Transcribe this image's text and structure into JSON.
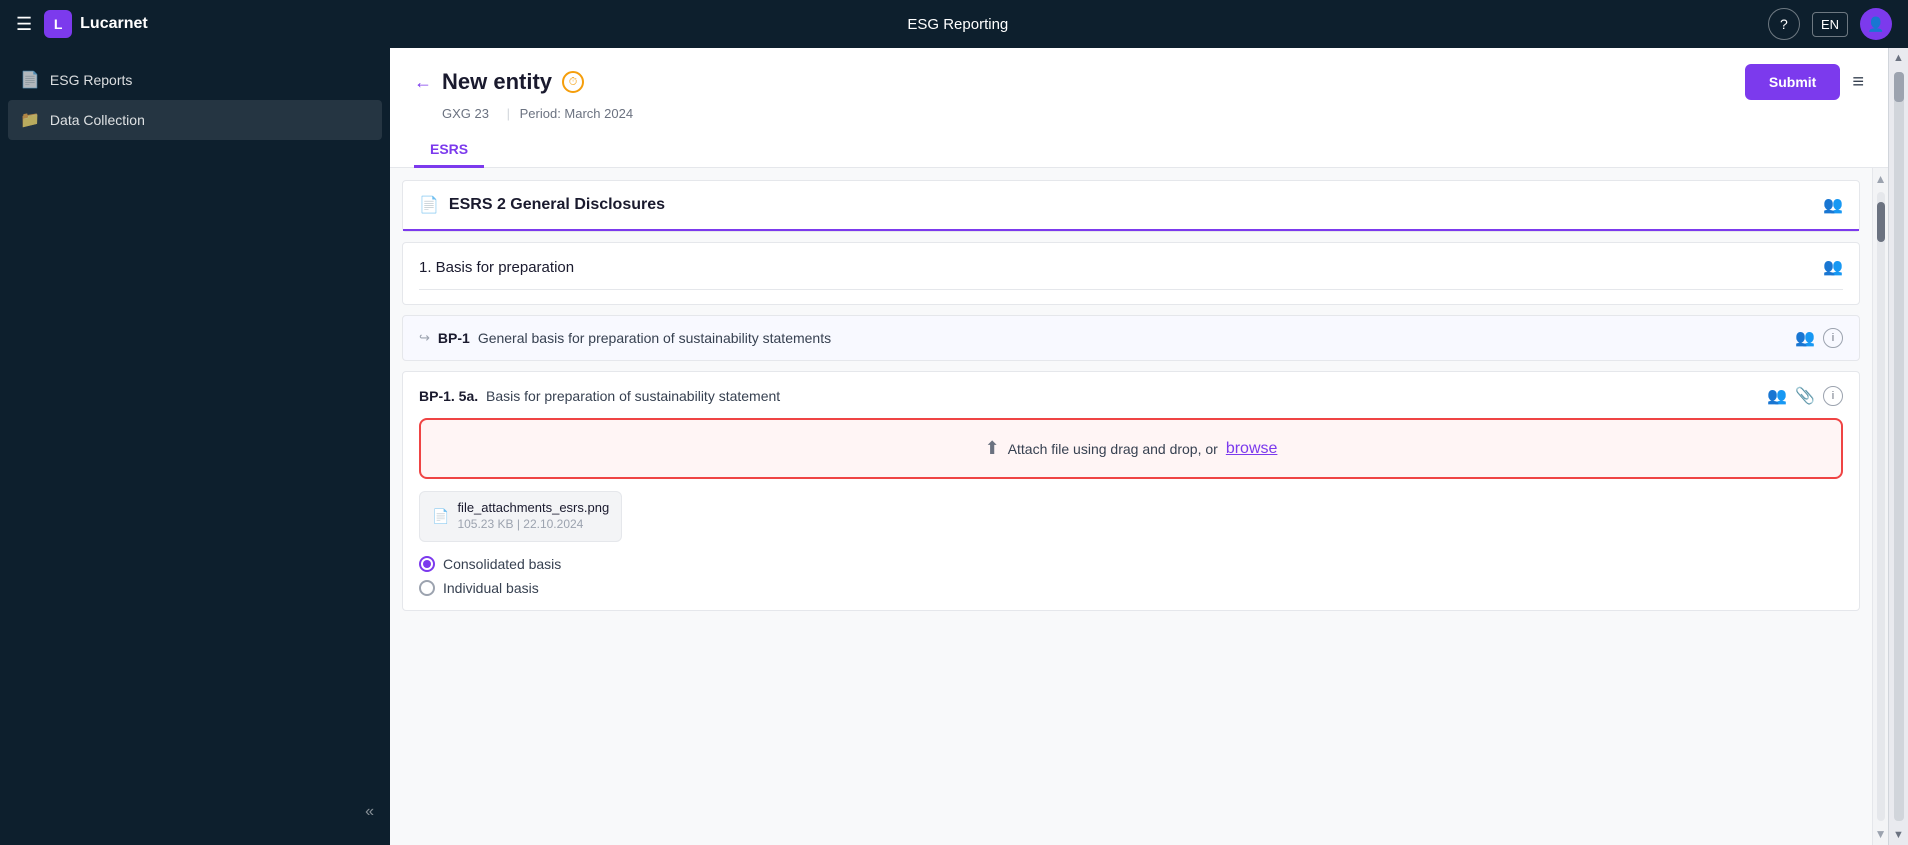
{
  "app": {
    "name": "Lucarnet",
    "title": "ESG Reporting"
  },
  "topnav": {
    "menu_label": "☰",
    "logo_text": "Lucarnet",
    "center_title": "ESG Reporting",
    "help_label": "?",
    "lang_label": "EN",
    "avatar_label": "👤"
  },
  "sidebar": {
    "items": [
      {
        "id": "esg-reports",
        "label": "ESG Reports",
        "icon": "📄",
        "active": false
      },
      {
        "id": "data-collection",
        "label": "Data Collection",
        "icon": "📁",
        "active": true
      }
    ],
    "collapse_icon": "«"
  },
  "entity": {
    "back_label": "←",
    "title": "New entity",
    "clock_icon": "⏱",
    "meta_code": "GXG 23",
    "meta_sep": "|",
    "meta_period": "Period: March 2024",
    "submit_label": "Submit",
    "hamburger_label": "≡"
  },
  "tabs": [
    {
      "id": "esrs",
      "label": "ESRS",
      "active": true
    }
  ],
  "content": {
    "section_title": "ESRS 2 General Disclosures",
    "section_doc_icon": "📄",
    "subsection_title": "1. Basis for preparation",
    "bp1": {
      "arrow": "↪",
      "code": "BP-1",
      "description": "General basis for preparation of sustainability statements"
    },
    "bp1_5a": {
      "code": "BP-1. 5a.",
      "description": "Basis for preparation of sustainability statement"
    },
    "dropzone": {
      "upload_icon": "⬆",
      "text": "Attach file using drag and drop, or",
      "link_label": "browse"
    },
    "file": {
      "icon": "📄",
      "name": "file_attachments_esrs.png",
      "size": "105.23 KB",
      "sep": "|",
      "date": "22.10.2024"
    },
    "radios": [
      {
        "id": "consolidated",
        "label": "Consolidated basis",
        "checked": true
      },
      {
        "id": "individual",
        "label": "Individual basis",
        "checked": false
      }
    ]
  }
}
